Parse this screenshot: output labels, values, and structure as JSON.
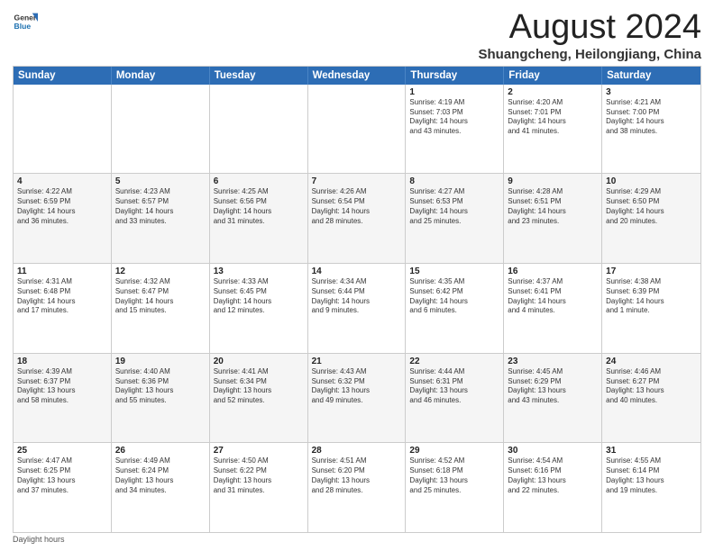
{
  "logo": {
    "line1": "General",
    "line2": "Blue"
  },
  "title": "August 2024",
  "location": "Shuangcheng, Heilongjiang, China",
  "days_of_week": [
    "Sunday",
    "Monday",
    "Tuesday",
    "Wednesday",
    "Thursday",
    "Friday",
    "Saturday"
  ],
  "footer": "Daylight hours",
  "weeks": [
    [
      {
        "day": "",
        "info": ""
      },
      {
        "day": "",
        "info": ""
      },
      {
        "day": "",
        "info": ""
      },
      {
        "day": "",
        "info": ""
      },
      {
        "day": "1",
        "info": "Sunrise: 4:19 AM\nSunset: 7:03 PM\nDaylight: 14 hours\nand 43 minutes."
      },
      {
        "day": "2",
        "info": "Sunrise: 4:20 AM\nSunset: 7:01 PM\nDaylight: 14 hours\nand 41 minutes."
      },
      {
        "day": "3",
        "info": "Sunrise: 4:21 AM\nSunset: 7:00 PM\nDaylight: 14 hours\nand 38 minutes."
      }
    ],
    [
      {
        "day": "4",
        "info": "Sunrise: 4:22 AM\nSunset: 6:59 PM\nDaylight: 14 hours\nand 36 minutes."
      },
      {
        "day": "5",
        "info": "Sunrise: 4:23 AM\nSunset: 6:57 PM\nDaylight: 14 hours\nand 33 minutes."
      },
      {
        "day": "6",
        "info": "Sunrise: 4:25 AM\nSunset: 6:56 PM\nDaylight: 14 hours\nand 31 minutes."
      },
      {
        "day": "7",
        "info": "Sunrise: 4:26 AM\nSunset: 6:54 PM\nDaylight: 14 hours\nand 28 minutes."
      },
      {
        "day": "8",
        "info": "Sunrise: 4:27 AM\nSunset: 6:53 PM\nDaylight: 14 hours\nand 25 minutes."
      },
      {
        "day": "9",
        "info": "Sunrise: 4:28 AM\nSunset: 6:51 PM\nDaylight: 14 hours\nand 23 minutes."
      },
      {
        "day": "10",
        "info": "Sunrise: 4:29 AM\nSunset: 6:50 PM\nDaylight: 14 hours\nand 20 minutes."
      }
    ],
    [
      {
        "day": "11",
        "info": "Sunrise: 4:31 AM\nSunset: 6:48 PM\nDaylight: 14 hours\nand 17 minutes."
      },
      {
        "day": "12",
        "info": "Sunrise: 4:32 AM\nSunset: 6:47 PM\nDaylight: 14 hours\nand 15 minutes."
      },
      {
        "day": "13",
        "info": "Sunrise: 4:33 AM\nSunset: 6:45 PM\nDaylight: 14 hours\nand 12 minutes."
      },
      {
        "day": "14",
        "info": "Sunrise: 4:34 AM\nSunset: 6:44 PM\nDaylight: 14 hours\nand 9 minutes."
      },
      {
        "day": "15",
        "info": "Sunrise: 4:35 AM\nSunset: 6:42 PM\nDaylight: 14 hours\nand 6 minutes."
      },
      {
        "day": "16",
        "info": "Sunrise: 4:37 AM\nSunset: 6:41 PM\nDaylight: 14 hours\nand 4 minutes."
      },
      {
        "day": "17",
        "info": "Sunrise: 4:38 AM\nSunset: 6:39 PM\nDaylight: 14 hours\nand 1 minute."
      }
    ],
    [
      {
        "day": "18",
        "info": "Sunrise: 4:39 AM\nSunset: 6:37 PM\nDaylight: 13 hours\nand 58 minutes."
      },
      {
        "day": "19",
        "info": "Sunrise: 4:40 AM\nSunset: 6:36 PM\nDaylight: 13 hours\nand 55 minutes."
      },
      {
        "day": "20",
        "info": "Sunrise: 4:41 AM\nSunset: 6:34 PM\nDaylight: 13 hours\nand 52 minutes."
      },
      {
        "day": "21",
        "info": "Sunrise: 4:43 AM\nSunset: 6:32 PM\nDaylight: 13 hours\nand 49 minutes."
      },
      {
        "day": "22",
        "info": "Sunrise: 4:44 AM\nSunset: 6:31 PM\nDaylight: 13 hours\nand 46 minutes."
      },
      {
        "day": "23",
        "info": "Sunrise: 4:45 AM\nSunset: 6:29 PM\nDaylight: 13 hours\nand 43 minutes."
      },
      {
        "day": "24",
        "info": "Sunrise: 4:46 AM\nSunset: 6:27 PM\nDaylight: 13 hours\nand 40 minutes."
      }
    ],
    [
      {
        "day": "25",
        "info": "Sunrise: 4:47 AM\nSunset: 6:25 PM\nDaylight: 13 hours\nand 37 minutes."
      },
      {
        "day": "26",
        "info": "Sunrise: 4:49 AM\nSunset: 6:24 PM\nDaylight: 13 hours\nand 34 minutes."
      },
      {
        "day": "27",
        "info": "Sunrise: 4:50 AM\nSunset: 6:22 PM\nDaylight: 13 hours\nand 31 minutes."
      },
      {
        "day": "28",
        "info": "Sunrise: 4:51 AM\nSunset: 6:20 PM\nDaylight: 13 hours\nand 28 minutes."
      },
      {
        "day": "29",
        "info": "Sunrise: 4:52 AM\nSunset: 6:18 PM\nDaylight: 13 hours\nand 25 minutes."
      },
      {
        "day": "30",
        "info": "Sunrise: 4:54 AM\nSunset: 6:16 PM\nDaylight: 13 hours\nand 22 minutes."
      },
      {
        "day": "31",
        "info": "Sunrise: 4:55 AM\nSunset: 6:14 PM\nDaylight: 13 hours\nand 19 minutes."
      }
    ]
  ]
}
